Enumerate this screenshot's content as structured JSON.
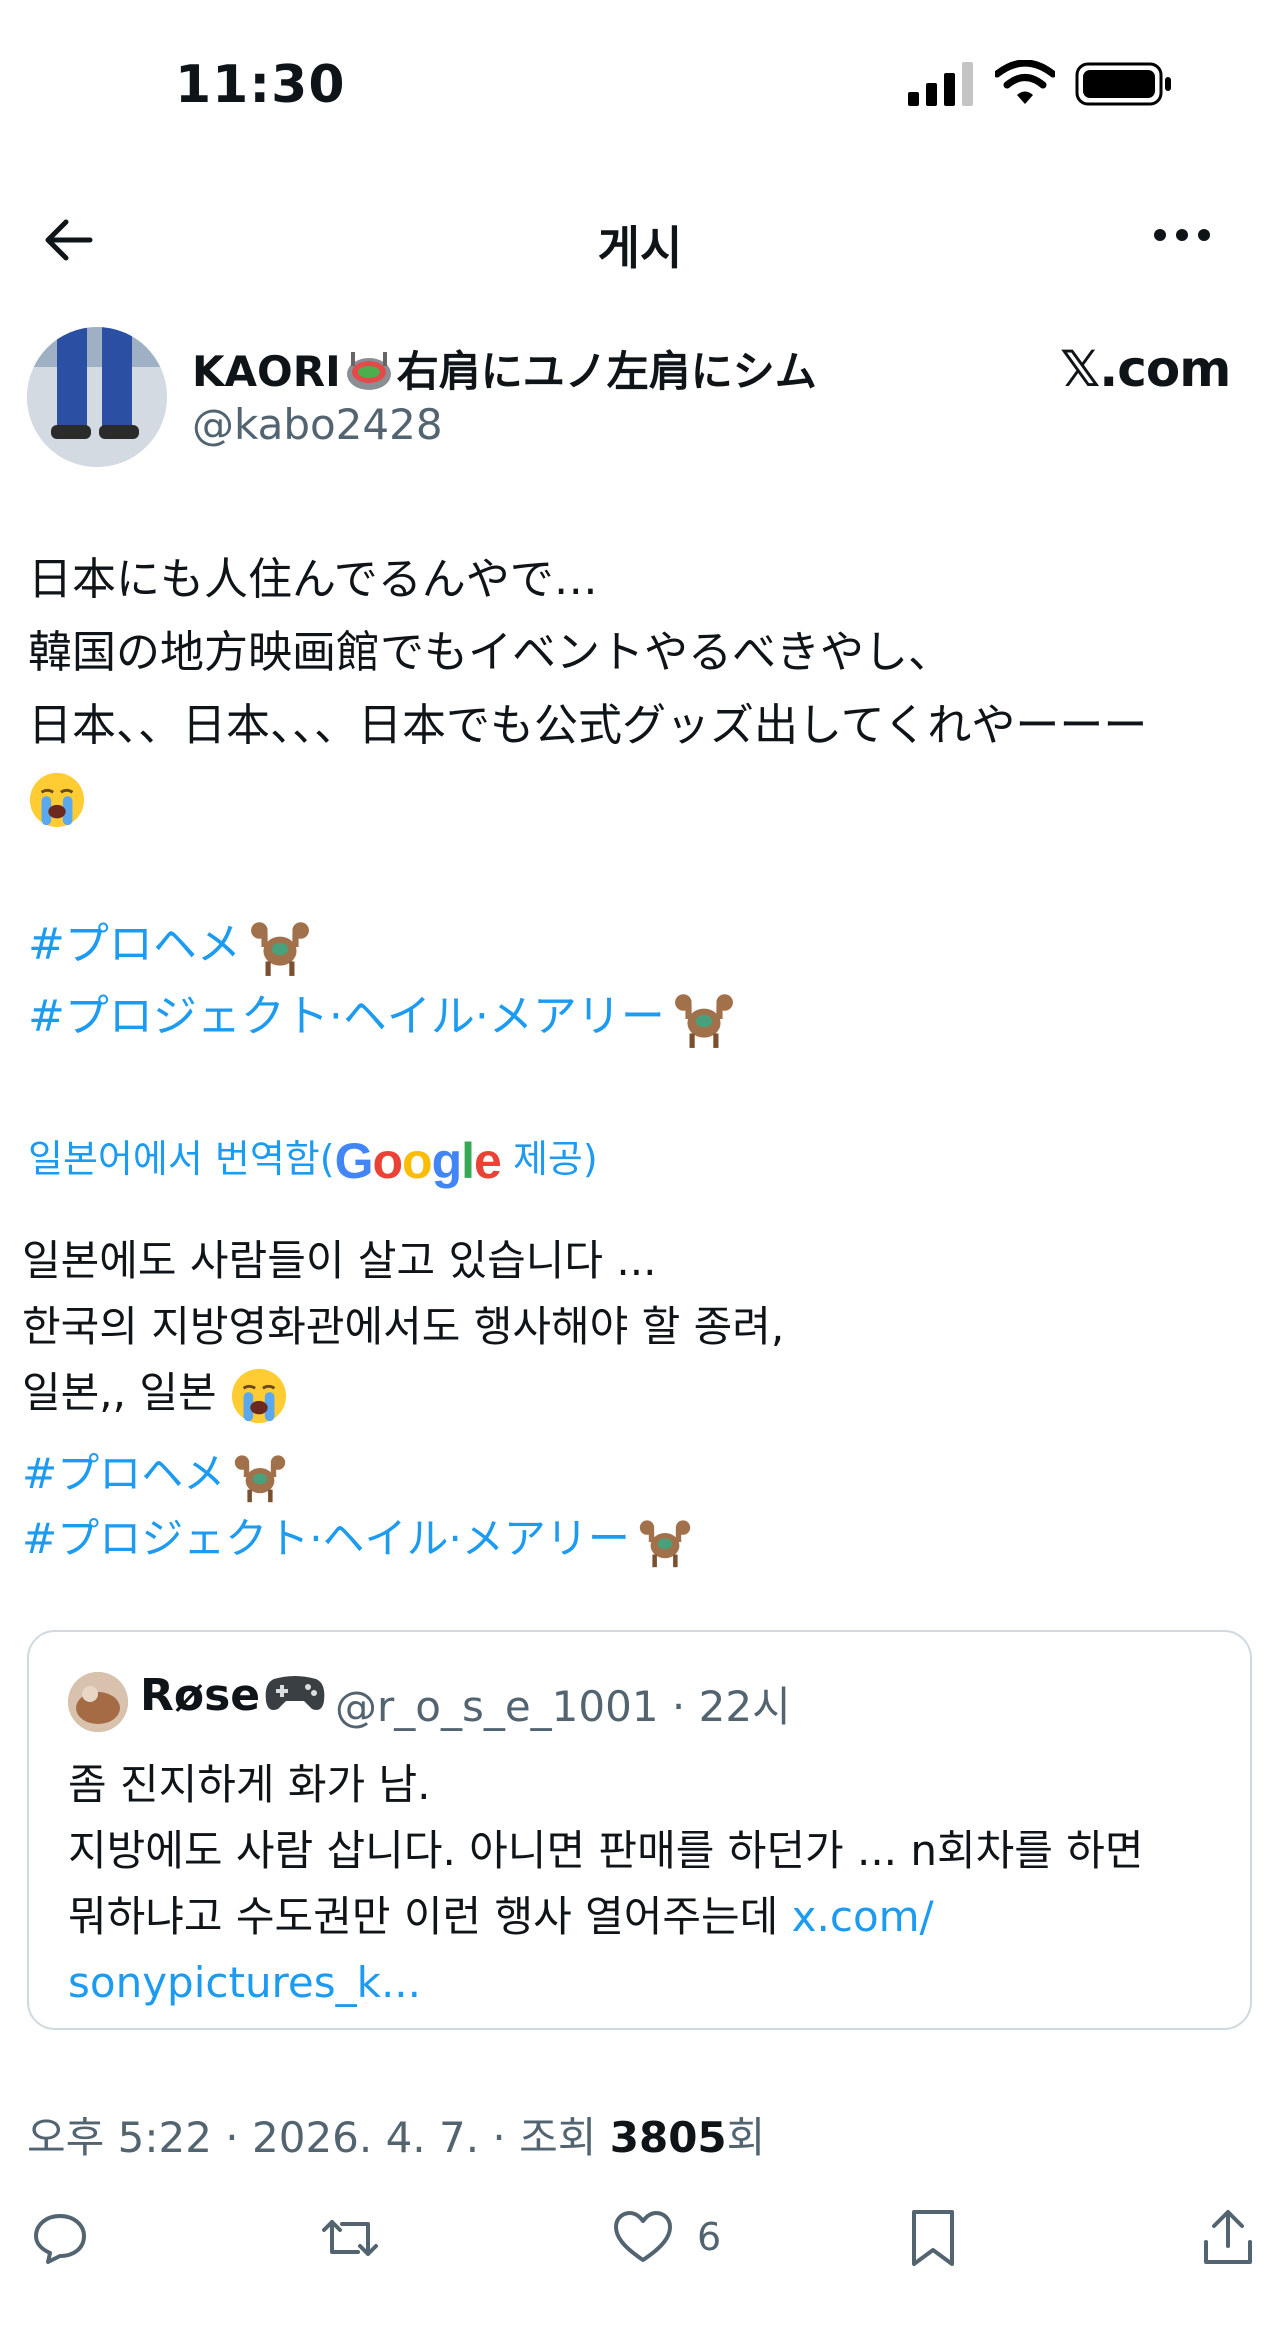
{
  "status_bar": {
    "time": "11:30"
  },
  "header": {
    "title": "게시"
  },
  "author": {
    "name_prefix": "KAORI",
    "name_suffix": "右肩にユノ左肩にシム",
    "handle": "@kabo2428",
    "site_label": "𝕏.com"
  },
  "tweet": {
    "lines": [
      "日本にも人住んでるんやで…",
      "韓国の地方映画館でもイベントやるべきやし、",
      "日本、、日本、、、日本でも公式グッズ出してくれやーーー"
    ],
    "hashtags": [
      "#プロヘメ",
      "#プロジェクト·ヘイル·メアリー"
    ]
  },
  "translation": {
    "note_prefix": "일본어에서 번역함(",
    "google_letters": [
      "G",
      "o",
      "o",
      "g",
      "l",
      "e"
    ],
    "note_suffix": " 제공)",
    "lines": [
      "일본에도 사람들이 살고 있습니다 ...",
      "한국의 지방영화관에서도 행사해야 할 종려,",
      "일본,, 일본"
    ],
    "hashtags": [
      "#プロヘメ",
      "#プロジェクト·ヘイル·メアリー"
    ]
  },
  "quote": {
    "name": "Røse",
    "meta": "@r_o_s_e_1001 · 22시",
    "lines": [
      "좀 진지하게 화가 남.",
      "지방에도 사람 삽니다. 아니면 판매를 하던가 ... n회차를 하면",
      "뭐하냐고 수도권만 이런 행사 열어주는데 "
    ],
    "link_part1": "x.com/",
    "link_part2": "sonypictures_k..."
  },
  "meta": {
    "time_date": "오후 5:22 · 2026. 4. 7. · 조회 ",
    "views": "3805",
    "views_suffix": "회"
  },
  "actions": {
    "like_count": "6"
  },
  "colors": {
    "accent": "#1d9bf0",
    "secondary_text": "#536471",
    "border": "#cfd9de"
  }
}
